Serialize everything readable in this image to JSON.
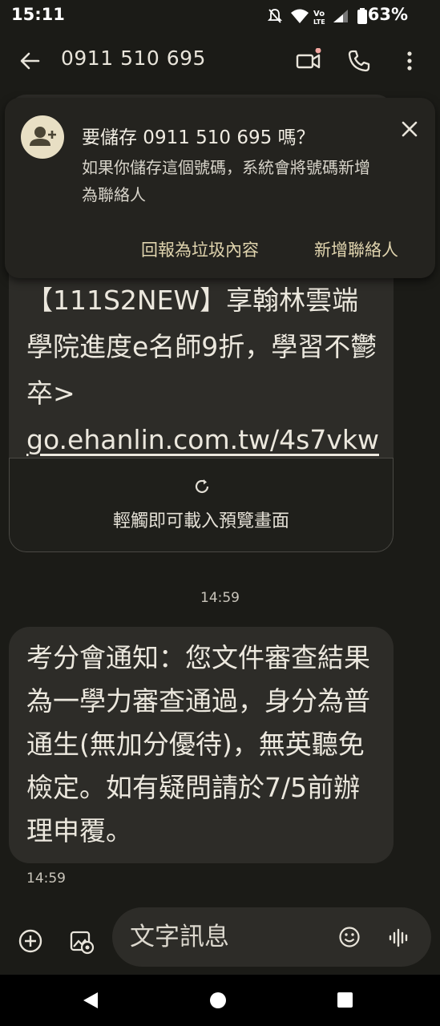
{
  "status_bar": {
    "time": "15:11",
    "battery": "63%"
  },
  "app_bar": {
    "contact_number": "0911 510 695"
  },
  "save_card": {
    "title": "要儲存 0911 510 695 嗎？",
    "description": "如果你儲存這個號碼，系統會將號碼新增為聯絡人",
    "report_spam_label": "回報為垃圾內容",
    "add_contact_label": "新增聯絡人"
  },
  "messages": [
    {
      "text_before_link": "【111S2NEW】享翰林雲端學院進度e名師9折，學習不鬱卒> ",
      "link": "go.ehanlin.com.tw/4s7vkw",
      "preview_label": "輕觸即可載入預覽畫面",
      "timestamp": "14:59"
    },
    {
      "text": "考分會通知：您文件審查結果為一學力審查通過，身分為普通生(無加分優待)，無英聽免檢定。如有疑問請於7/5前辦理申覆。",
      "timestamp": "14:59"
    }
  ],
  "compose": {
    "placeholder": "文字訊息"
  },
  "colors": {
    "background": "#1b1b17",
    "bubble": "#2d2c28",
    "accent_text": "#e0d4ae",
    "avatar": "#e8dfc4"
  }
}
